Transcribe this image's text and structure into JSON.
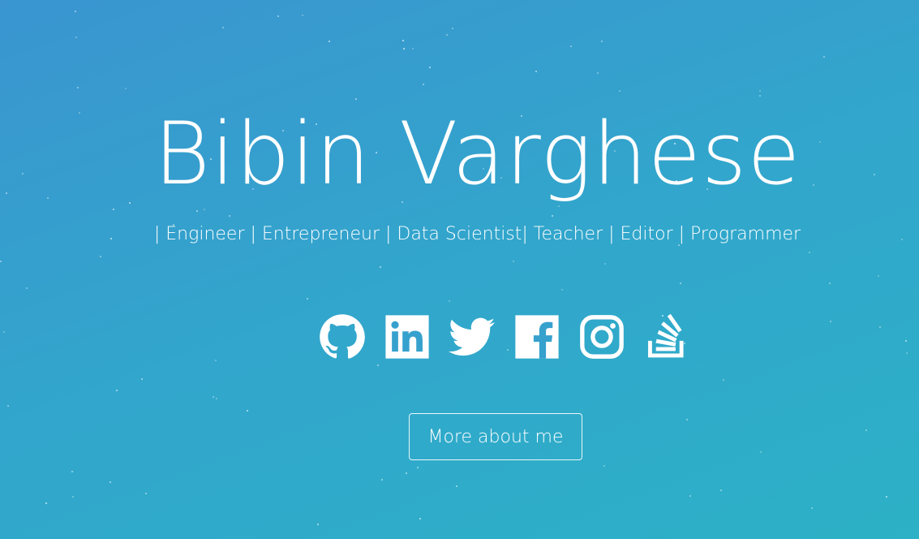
{
  "hero": {
    "name": "Bibin Varghese",
    "tagline": "| Engineer | Entrepreneur | Data Scientist| Teacher | Editor | Programmer"
  },
  "social": [
    {
      "icon": "github-icon"
    },
    {
      "icon": "linkedin-icon"
    },
    {
      "icon": "twitter-icon"
    },
    {
      "icon": "facebook-icon"
    },
    {
      "icon": "instagram-icon"
    },
    {
      "icon": "stackoverflow-icon"
    }
  ],
  "cta": {
    "label": "More about me"
  },
  "colors": {
    "gradient_start": "#3a95d0",
    "gradient_end": "#2cb1c6",
    "text": "#ffffff"
  }
}
